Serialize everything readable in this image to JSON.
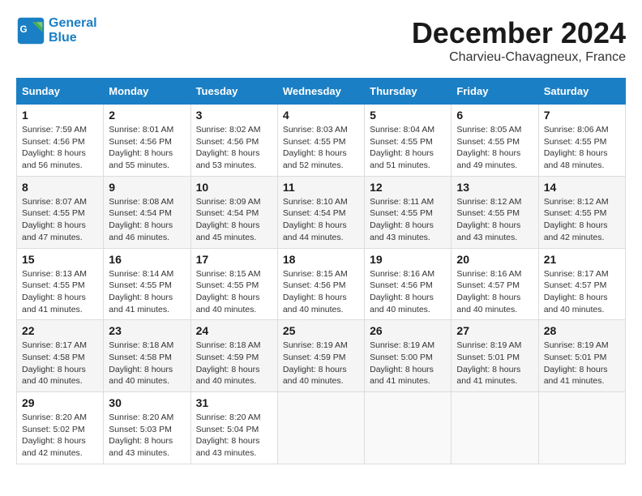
{
  "header": {
    "logo": {
      "line1": "General",
      "line2": "Blue"
    },
    "title": "December 2024",
    "location": "Charvieu-Chavagneux, France"
  },
  "weekdays": [
    "Sunday",
    "Monday",
    "Tuesday",
    "Wednesday",
    "Thursday",
    "Friday",
    "Saturday"
  ],
  "weeks": [
    [
      {
        "day": 1,
        "sunrise": "7:59 AM",
        "sunset": "4:56 PM",
        "daylight": "8 hours and 56 minutes."
      },
      {
        "day": 2,
        "sunrise": "8:01 AM",
        "sunset": "4:56 PM",
        "daylight": "8 hours and 55 minutes."
      },
      {
        "day": 3,
        "sunrise": "8:02 AM",
        "sunset": "4:56 PM",
        "daylight": "8 hours and 53 minutes."
      },
      {
        "day": 4,
        "sunrise": "8:03 AM",
        "sunset": "4:55 PM",
        "daylight": "8 hours and 52 minutes."
      },
      {
        "day": 5,
        "sunrise": "8:04 AM",
        "sunset": "4:55 PM",
        "daylight": "8 hours and 51 minutes."
      },
      {
        "day": 6,
        "sunrise": "8:05 AM",
        "sunset": "4:55 PM",
        "daylight": "8 hours and 49 minutes."
      },
      {
        "day": 7,
        "sunrise": "8:06 AM",
        "sunset": "4:55 PM",
        "daylight": "8 hours and 48 minutes."
      }
    ],
    [
      {
        "day": 8,
        "sunrise": "8:07 AM",
        "sunset": "4:55 PM",
        "daylight": "8 hours and 47 minutes."
      },
      {
        "day": 9,
        "sunrise": "8:08 AM",
        "sunset": "4:54 PM",
        "daylight": "8 hours and 46 minutes."
      },
      {
        "day": 10,
        "sunrise": "8:09 AM",
        "sunset": "4:54 PM",
        "daylight": "8 hours and 45 minutes."
      },
      {
        "day": 11,
        "sunrise": "8:10 AM",
        "sunset": "4:54 PM",
        "daylight": "8 hours and 44 minutes."
      },
      {
        "day": 12,
        "sunrise": "8:11 AM",
        "sunset": "4:55 PM",
        "daylight": "8 hours and 43 minutes."
      },
      {
        "day": 13,
        "sunrise": "8:12 AM",
        "sunset": "4:55 PM",
        "daylight": "8 hours and 43 minutes."
      },
      {
        "day": 14,
        "sunrise": "8:12 AM",
        "sunset": "4:55 PM",
        "daylight": "8 hours and 42 minutes."
      }
    ],
    [
      {
        "day": 15,
        "sunrise": "8:13 AM",
        "sunset": "4:55 PM",
        "daylight": "8 hours and 41 minutes."
      },
      {
        "day": 16,
        "sunrise": "8:14 AM",
        "sunset": "4:55 PM",
        "daylight": "8 hours and 41 minutes."
      },
      {
        "day": 17,
        "sunrise": "8:15 AM",
        "sunset": "4:55 PM",
        "daylight": "8 hours and 40 minutes."
      },
      {
        "day": 18,
        "sunrise": "8:15 AM",
        "sunset": "4:56 PM",
        "daylight": "8 hours and 40 minutes."
      },
      {
        "day": 19,
        "sunrise": "8:16 AM",
        "sunset": "4:56 PM",
        "daylight": "8 hours and 40 minutes."
      },
      {
        "day": 20,
        "sunrise": "8:16 AM",
        "sunset": "4:57 PM",
        "daylight": "8 hours and 40 minutes."
      },
      {
        "day": 21,
        "sunrise": "8:17 AM",
        "sunset": "4:57 PM",
        "daylight": "8 hours and 40 minutes."
      }
    ],
    [
      {
        "day": 22,
        "sunrise": "8:17 AM",
        "sunset": "4:58 PM",
        "daylight": "8 hours and 40 minutes."
      },
      {
        "day": 23,
        "sunrise": "8:18 AM",
        "sunset": "4:58 PM",
        "daylight": "8 hours and 40 minutes."
      },
      {
        "day": 24,
        "sunrise": "8:18 AM",
        "sunset": "4:59 PM",
        "daylight": "8 hours and 40 minutes."
      },
      {
        "day": 25,
        "sunrise": "8:19 AM",
        "sunset": "4:59 PM",
        "daylight": "8 hours and 40 minutes."
      },
      {
        "day": 26,
        "sunrise": "8:19 AM",
        "sunset": "5:00 PM",
        "daylight": "8 hours and 41 minutes."
      },
      {
        "day": 27,
        "sunrise": "8:19 AM",
        "sunset": "5:01 PM",
        "daylight": "8 hours and 41 minutes."
      },
      {
        "day": 28,
        "sunrise": "8:19 AM",
        "sunset": "5:01 PM",
        "daylight": "8 hours and 41 minutes."
      }
    ],
    [
      {
        "day": 29,
        "sunrise": "8:20 AM",
        "sunset": "5:02 PM",
        "daylight": "8 hours and 42 minutes."
      },
      {
        "day": 30,
        "sunrise": "8:20 AM",
        "sunset": "5:03 PM",
        "daylight": "8 hours and 43 minutes."
      },
      {
        "day": 31,
        "sunrise": "8:20 AM",
        "sunset": "5:04 PM",
        "daylight": "8 hours and 43 minutes."
      },
      null,
      null,
      null,
      null
    ]
  ]
}
